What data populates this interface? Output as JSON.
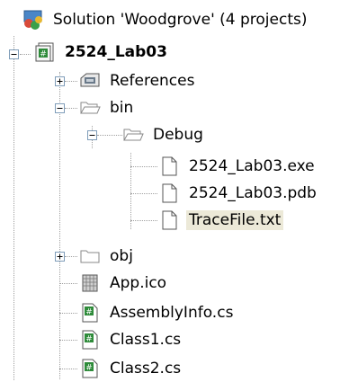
{
  "solution_explorer": {
    "nodes": [
      {
        "label": "Solution 'Woodgrove' (4 projects)",
        "icon": "solution-icon",
        "bold": false,
        "selected": false,
        "expander": null
      },
      {
        "label": "2524_Lab03",
        "icon": "csharp-project-icon",
        "bold": true,
        "selected": false,
        "expander": "expanded"
      },
      {
        "label": "References",
        "icon": "references-icon",
        "bold": false,
        "selected": false,
        "expander": "collapsed"
      },
      {
        "label": "bin",
        "icon": "folder-open-icon",
        "bold": false,
        "selected": false,
        "expander": "expanded"
      },
      {
        "label": "Debug",
        "icon": "folder-open-icon",
        "bold": false,
        "selected": false,
        "expander": "expanded"
      },
      {
        "label": "2524_Lab03.exe",
        "icon": "file-icon",
        "bold": false,
        "selected": false,
        "expander": null
      },
      {
        "label": "2524_Lab03.pdb",
        "icon": "file-icon",
        "bold": false,
        "selected": false,
        "expander": null
      },
      {
        "label": "TraceFile.txt",
        "icon": "file-icon",
        "bold": false,
        "selected": true,
        "expander": null
      },
      {
        "label": "obj",
        "icon": "folder-closed-icon",
        "bold": false,
        "selected": false,
        "expander": "collapsed"
      },
      {
        "label": "App.ico",
        "icon": "icon-file-icon",
        "bold": false,
        "selected": false,
        "expander": null
      },
      {
        "label": "AssemblyInfo.cs",
        "icon": "csharp-file-icon",
        "bold": false,
        "selected": false,
        "expander": null
      },
      {
        "label": "Class1.cs",
        "icon": "csharp-file-icon",
        "bold": false,
        "selected": false,
        "expander": null
      },
      {
        "label": "Class2.cs",
        "icon": "csharp-file-icon",
        "bold": false,
        "selected": false,
        "expander": null
      }
    ]
  }
}
